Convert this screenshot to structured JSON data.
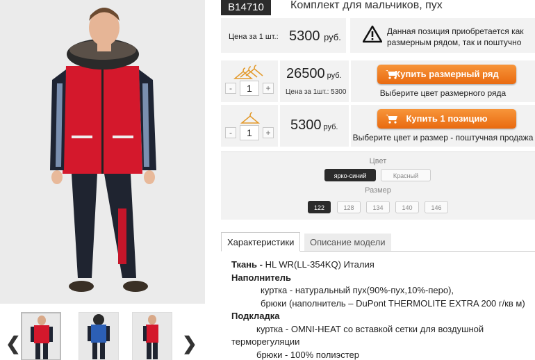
{
  "product": {
    "sku": "B14710",
    "title": "Комплект для мальчиков, пух"
  },
  "unit_price": {
    "label": "Цена за 1 шт.:",
    "value": "5300",
    "currency": "руб."
  },
  "notice": {
    "icon": "warning-icon",
    "line1": "Данная позиция приобретается как",
    "line2": "размерным рядом, так и поштучно"
  },
  "size_row": {
    "qty": "1",
    "minus": "-",
    "plus": "+",
    "price": "26500",
    "currency": "руб.",
    "sub_price": "Цена за 1шт.: 5300",
    "button": "Купить размерный ряд",
    "hint": "Выберите цвет размерного ряда"
  },
  "single_row": {
    "qty": "1",
    "minus": "-",
    "plus": "+",
    "price": "5300",
    "currency": "руб.",
    "button": "Купить 1 позицию",
    "hint": "Выберите цвет и размер - поштучная продажа"
  },
  "options": {
    "color_label": "Цвет",
    "colors": [
      "ярко-синий",
      "Красный"
    ],
    "selected_color": "ярко-синий",
    "size_label": "Размер",
    "sizes": [
      "122",
      "128",
      "134",
      "140",
      "146"
    ],
    "selected_size": "122"
  },
  "tabs": {
    "specs": "Характеристики",
    "description": "Описание модели"
  },
  "specs": {
    "fabric_label": "Ткань - ",
    "fabric_value": "HL WR(LL-354KQ) Италия",
    "filler_label": "Наполнитель",
    "filler_1": "куртка - натуральный пух(90%-пух,10%-перо),",
    "filler_2": "брюки (наполнитель – DuPont THERMOLITE EXTRA 200 г/кв м)",
    "lining_label": "Подкладка",
    "lining_1": "куртка - OMNI-HEAT со вставкой сетки для воздушной",
    "lining_1b": "терморегуляции",
    "lining_2": "брюки - 100% полиэстер"
  },
  "colors": {
    "accent_orange": "#f08020",
    "dark": "#2b2b2b",
    "panel": "#f2f2f2"
  }
}
